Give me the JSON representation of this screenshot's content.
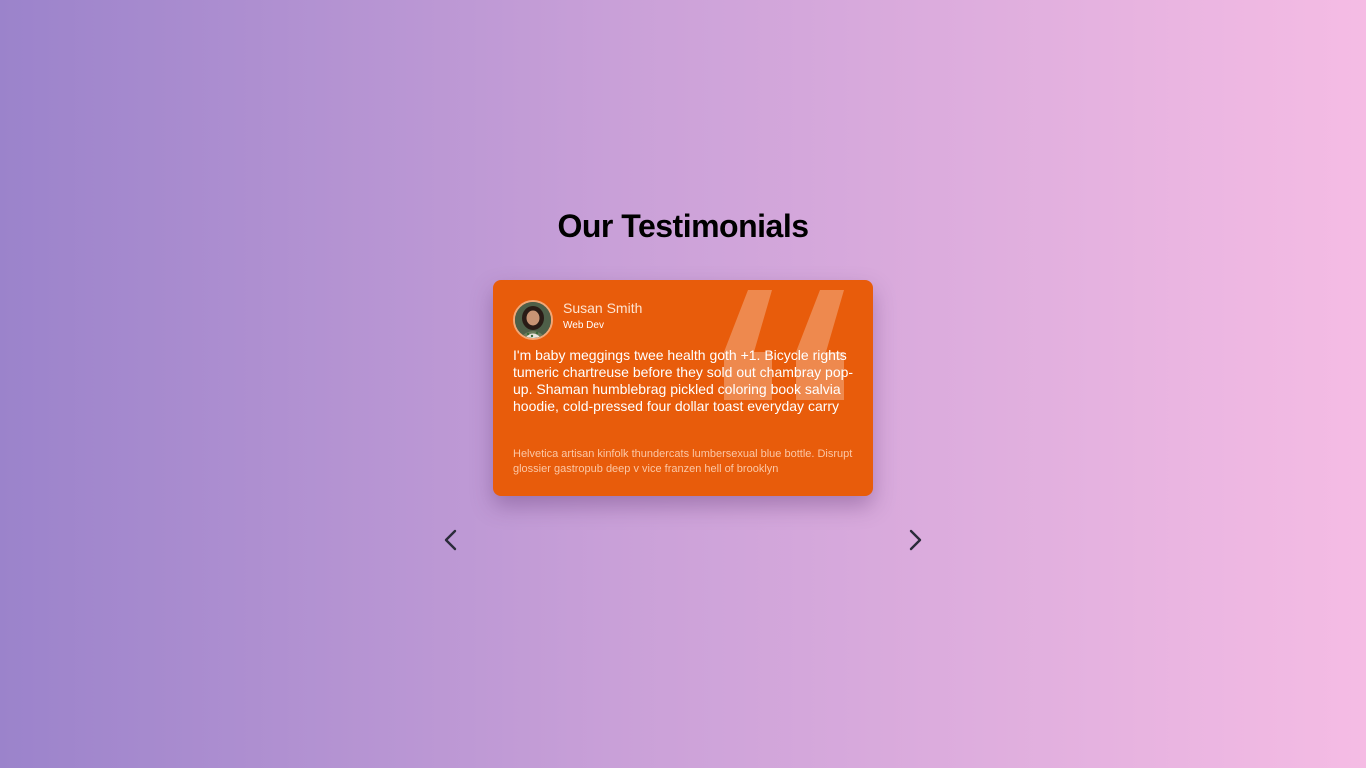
{
  "page": {
    "title": "Our Testimonials"
  },
  "testimonial": {
    "name": "Susan Smith",
    "role": "Web Dev",
    "text": "I'm baby meggings twee health goth +1. Bicycle rights tumeric chartreuse before they sold out chambray pop-up. Shaman humblebrag pickled coloring book salvia hoodie, cold-pressed four dollar toast everyday carry",
    "subtext": "Helvetica artisan kinfolk thundercats lumbersexual blue bottle. Disrupt glossier gastropub deep v vice franzen hell of brooklyn",
    "card_color": "#e85c0b"
  },
  "icons": {
    "prev": "chevron-left-icon",
    "next": "chevron-right-icon",
    "quote": "quote-icon"
  }
}
